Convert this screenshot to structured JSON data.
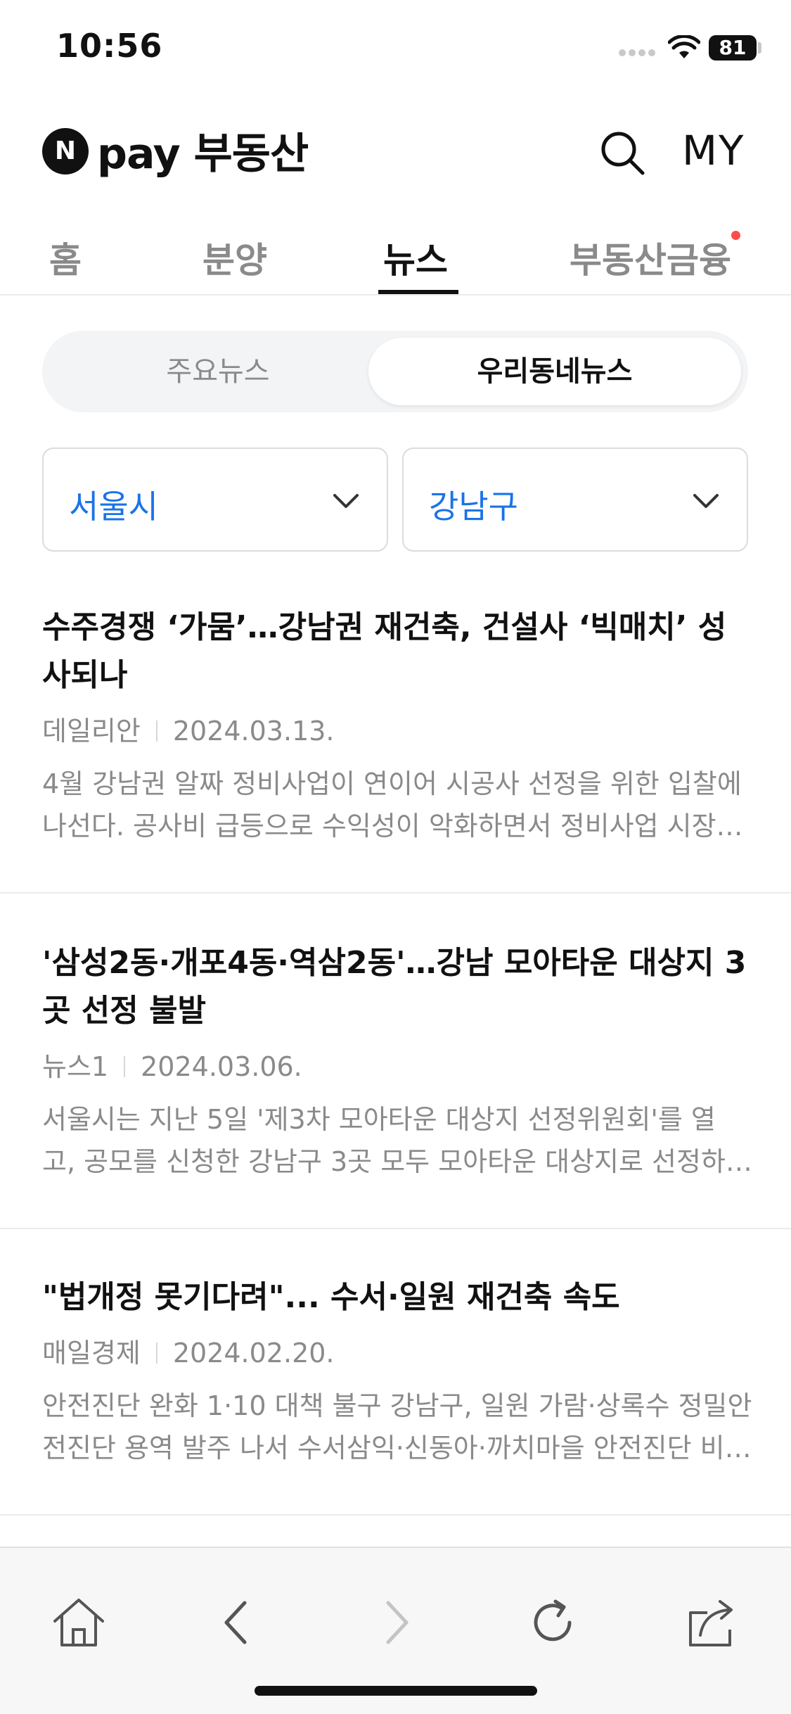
{
  "status_bar": {
    "time": "10:56",
    "battery": "81"
  },
  "header": {
    "logo_mark": "N",
    "logo_text": "pay 부동산",
    "search_icon": "search-icon",
    "my_label": "MY"
  },
  "tabs": [
    {
      "label": "홈",
      "active": false
    },
    {
      "label": "분양",
      "active": false
    },
    {
      "label": "뉴스",
      "active": true
    },
    {
      "label": "부동산금융",
      "active": false,
      "badge_dot": true
    }
  ],
  "segments": [
    {
      "label": "주요뉴스",
      "active": false
    },
    {
      "label": "우리동네뉴스",
      "active": true
    }
  ],
  "filters": {
    "city": "서울시",
    "district": "강남구"
  },
  "news": [
    {
      "title": "수주경쟁 ‘가뭄’…강남권 재건축, 건설사 ‘빅매치’ 성사되나",
      "source": "데일리안",
      "date": "2024.03.13.",
      "summary": [
        "4월 강남권 알짜 정비사업이 연이어 시공사 선정을 위한 입찰에",
        "나선다. 공사비 급등으로 수익성이 악화하면서 정비사업 시장…"
      ]
    },
    {
      "title": "'삼성2동·개포4동·역삼2동'…강남 모아타운 대상지 3곳 선정 불발",
      "source": "뉴스1",
      "date": "2024.03.06.",
      "summary": [
        "서울시는 지난 5일 '제3차 모아타운 대상지 선정위원회'를 열",
        "고, 공모를 신청한 강남구 3곳 모두 모아타운 대상지로 선정하…"
      ]
    },
    {
      "title": "\"법개정 못기다려\"... 수서·일원 재건축 속도",
      "source": "매일경제",
      "date": "2024.02.20.",
      "summary": [
        "안전진단 완화 1·10 대책 불구 강남구, 일원 가람·상록수 정밀안",
        "전진단 용역 발주 나서 수서삼익·신동아·까치마을 안전진단 비…"
      ]
    }
  ],
  "toolbar": {
    "icons": [
      "home-icon",
      "back-icon",
      "forward-icon",
      "refresh-icon",
      "share-icon"
    ]
  },
  "colors": {
    "accent_blue": "#1a73e8",
    "badge_red": "#ff4b4b",
    "muted_gray": "#8a8a8a"
  }
}
